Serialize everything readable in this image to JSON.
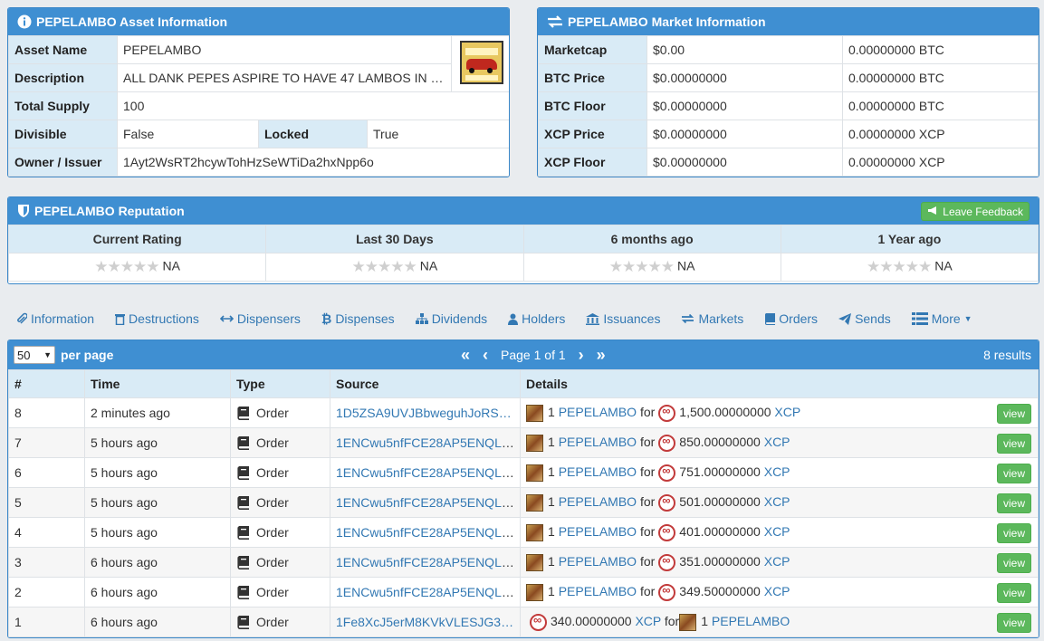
{
  "asset_info": {
    "title": "PEPELAMBO Asset Information",
    "rows": {
      "asset_name_label": "Asset Name",
      "asset_name": "PEPELAMBO",
      "description_label": "Description",
      "description": "ALL DANK PEPES ASPIRE TO HAVE 47 LAMBOS IN …",
      "supply_label": "Total Supply",
      "supply": "100",
      "divisible_label": "Divisible",
      "divisible": "False",
      "locked_label": "Locked",
      "locked": "True",
      "owner_label": "Owner / Issuer",
      "owner": "1Ayt2WsRT2hcywTohHzSeWTiDa2hxNpp6o"
    }
  },
  "market_info": {
    "title": "PEPELAMBO Market Information",
    "rows": [
      {
        "label": "Marketcap",
        "usd": "$0.00",
        "alt": "0.00000000 BTC"
      },
      {
        "label": "BTC Price",
        "usd": "$0.00000000",
        "alt": "0.00000000 BTC"
      },
      {
        "label": "BTC Floor",
        "usd": "$0.00000000",
        "alt": "0.00000000 BTC"
      },
      {
        "label": "XCP Price",
        "usd": "$0.00000000",
        "alt": "0.00000000 XCP"
      },
      {
        "label": "XCP Floor",
        "usd": "$0.00000000",
        "alt": "0.00000000 XCP"
      }
    ]
  },
  "reputation": {
    "title": "PEPELAMBO Reputation",
    "feedback_label": "Leave Feedback",
    "columns": [
      "Current Rating",
      "Last 30 Days",
      "6 months ago",
      "1 Year ago"
    ],
    "values": [
      "NA",
      "NA",
      "NA",
      "NA"
    ],
    "stars": "★★★★★"
  },
  "tabs": [
    "Information",
    "Destructions",
    "Dispensers",
    "Dispenses",
    "Dividends",
    "Holders",
    "Issuances",
    "Markets",
    "Orders",
    "Sends",
    "More"
  ],
  "list": {
    "per_page_value": "50",
    "per_page_label": "per page",
    "page_text": "Page 1 of 1",
    "results": "8 results",
    "columns": [
      "#",
      "Time",
      "Type",
      "Source",
      "Details"
    ],
    "view_label": "view",
    "rows": [
      {
        "num": "8",
        "time": "2 minutes ago",
        "type": "Order",
        "source": "1D5ZSA9UVJBbweguhJoRS…",
        "give_qty": "1",
        "give_asset": "PEPELAMBO",
        "for": "for",
        "get_qty": "1,500.00000000",
        "get_asset": "XCP"
      },
      {
        "num": "7",
        "time": "5 hours ago",
        "type": "Order",
        "source": "1ENCwu5nfFCE28AP5ENQLi…",
        "give_qty": "1",
        "give_asset": "PEPELAMBO",
        "for": "for",
        "get_qty": "850.00000000",
        "get_asset": "XCP"
      },
      {
        "num": "6",
        "time": "5 hours ago",
        "type": "Order",
        "source": "1ENCwu5nfFCE28AP5ENQLi…",
        "give_qty": "1",
        "give_asset": "PEPELAMBO",
        "for": "for",
        "get_qty": "751.00000000",
        "get_asset": "XCP"
      },
      {
        "num": "5",
        "time": "5 hours ago",
        "type": "Order",
        "source": "1ENCwu5nfFCE28AP5ENQLi…",
        "give_qty": "1",
        "give_asset": "PEPELAMBO",
        "for": "for",
        "get_qty": "501.00000000",
        "get_asset": "XCP"
      },
      {
        "num": "4",
        "time": "5 hours ago",
        "type": "Order",
        "source": "1ENCwu5nfFCE28AP5ENQLi…",
        "give_qty": "1",
        "give_asset": "PEPELAMBO",
        "for": "for",
        "get_qty": "401.00000000",
        "get_asset": "XCP"
      },
      {
        "num": "3",
        "time": "6 hours ago",
        "type": "Order",
        "source": "1ENCwu5nfFCE28AP5ENQLi…",
        "give_qty": "1",
        "give_asset": "PEPELAMBO",
        "for": "for",
        "get_qty": "351.00000000",
        "get_asset": "XCP"
      },
      {
        "num": "2",
        "time": "6 hours ago",
        "type": "Order",
        "source": "1ENCwu5nfFCE28AP5ENQLi…",
        "give_qty": "1",
        "give_asset": "PEPELAMBO",
        "for": "for",
        "get_qty": "349.50000000",
        "get_asset": "XCP"
      },
      {
        "num": "1",
        "time": "6 hours ago",
        "type": "Order",
        "source": "1Fe8XcJ5erM8KVkVLESJG3…",
        "give_qty": "340.00000000",
        "give_asset": "XCP",
        "for": "for",
        "get_qty": "1",
        "get_asset": "PEPELAMBO",
        "reversed": true
      }
    ]
  }
}
